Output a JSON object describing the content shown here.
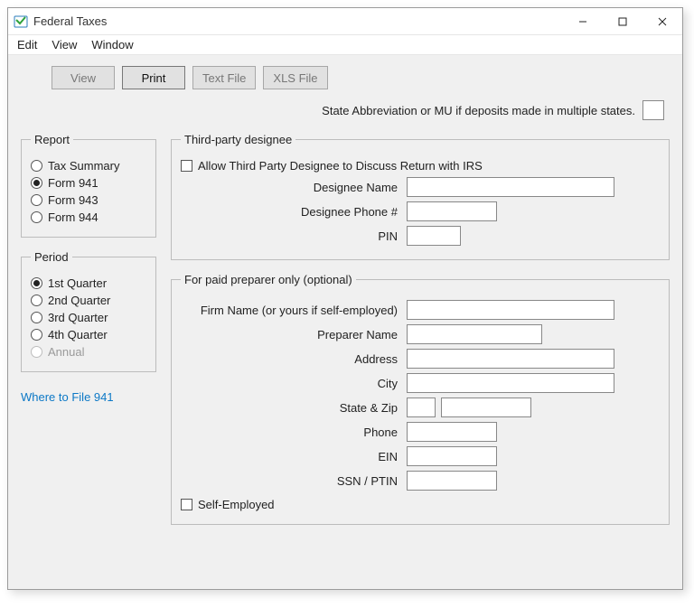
{
  "window": {
    "title": "Federal Taxes"
  },
  "menu": {
    "edit": "Edit",
    "view": "View",
    "window": "Window"
  },
  "toolbar": {
    "view": "View",
    "print": "Print",
    "textfile": "Text File",
    "xlsfile": "XLS File"
  },
  "state_abbrev_label": "State Abbreviation or MU if deposits made in multiple states.",
  "report": {
    "legend": "Report",
    "options": {
      "tax_summary": "Tax Summary",
      "form_941": "Form 941",
      "form_943": "Form 943",
      "form_944": "Form 944"
    },
    "selected": "form_941"
  },
  "period": {
    "legend": "Period",
    "options": {
      "q1": "1st Quarter",
      "q2": "2nd Quarter",
      "q3": "3rd Quarter",
      "q4": "4th Quarter",
      "annual": "Annual"
    },
    "selected": "q1",
    "disabled": [
      "annual"
    ]
  },
  "link_where_to_file": "Where to File 941",
  "designee": {
    "legend": "Third-party designee",
    "allow_label": "Allow Third Party Designee to Discuss Return with IRS",
    "name_label": "Designee Name",
    "phone_label": "Designee Phone #",
    "pin_label": "PIN"
  },
  "preparer": {
    "legend": "For paid preparer only (optional)",
    "firm_label": "Firm Name (or yours if self-employed)",
    "name_label": "Preparer Name",
    "address_label": "Address",
    "city_label": "City",
    "state_zip_label": "State & Zip",
    "phone_label": "Phone",
    "ein_label": "EIN",
    "ssn_ptin_label": "SSN / PTIN",
    "self_employed_label": "Self-Employed"
  }
}
